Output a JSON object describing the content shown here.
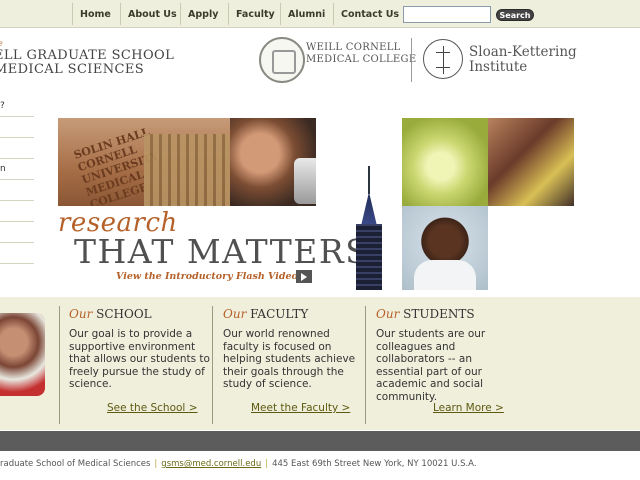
{
  "nav": {
    "items": [
      "Home",
      "About Us",
      "Apply",
      "Faculty",
      "Alumni",
      "Contact Us"
    ],
    "search_button": "Search",
    "search_value": ""
  },
  "header": {
    "school_small": "e",
    "school_title_line1": "ELL GRADUATE SCHOOL",
    "school_title_line2": "MEDICAL SCIENCES",
    "wcmc_line1": "WEILL CORNELL",
    "wcmc_line2": "MEDICAL COLLEGE",
    "ski_line1": "Sloan-Kettering",
    "ski_line2": "Institute"
  },
  "left_menu": [
    "?",
    "",
    "",
    "n",
    "",
    "",
    "",
    "",
    ""
  ],
  "hero": {
    "hall_text": "SOLIN HALL CORNELL UNIVERSITY MEDICAL COLLEGE",
    "research": "research",
    "matters": "THAT MATTERS",
    "flash_link": "View the Introductory Flash Video"
  },
  "columns": [
    {
      "our": "Our",
      "title": "SCHOOL",
      "body": "Our goal is to provide a supportive environment that allows our students to freely pursue the study of science.",
      "link": "See the School >"
    },
    {
      "our": "Our",
      "title": "FACULTY",
      "body": "Our world renowned faculty is focused on helping students achieve their goals through the study of science.",
      "link": "Meet the Faculty >"
    },
    {
      "our": "Our",
      "title": "STUDENTS",
      "body": "Our students are our colleagues and collaborators -- an essential part of our academic and social community.",
      "link": "Learn More >"
    }
  ],
  "footer": {
    "school": "raduate School of Medical Sciences",
    "email": "gsms@med.cornell.edu",
    "address": "445 East 69th Street New York, NY 10021 U.S.A."
  }
}
